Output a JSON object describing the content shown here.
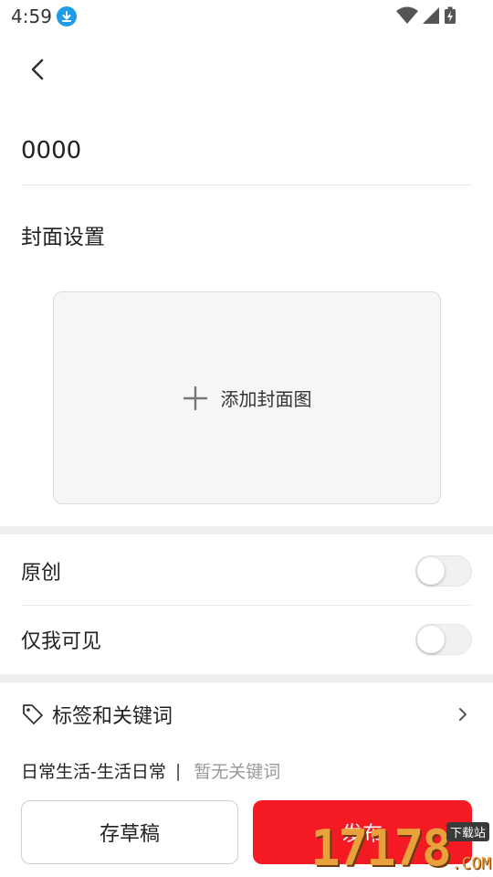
{
  "status": {
    "time": "4:59",
    "icons": [
      "download-icon",
      "wifi-icon",
      "signal-icon",
      "battery-charging-icon"
    ]
  },
  "header": {
    "back_icon": "back-arrow-icon"
  },
  "post": {
    "title_value": "0000"
  },
  "cover": {
    "section_label": "封面设置",
    "add_label": "添加封面图",
    "add_icon": "plus-icon"
  },
  "options": [
    {
      "label": "原创",
      "enabled": false
    },
    {
      "label": "仅我可见",
      "enabled": false
    }
  ],
  "tags": {
    "label": "标签和关键词",
    "icon": "tag-icon",
    "category": "日常生活-生活日常",
    "separator": "|",
    "keywords_placeholder": "暂无关键词"
  },
  "actions": {
    "draft_label": "存草稿",
    "publish_label": "发布",
    "publish_color": "#f41a23"
  },
  "watermark": {
    "number": "17178",
    "domain": ".COM",
    "tag": "下载站"
  }
}
